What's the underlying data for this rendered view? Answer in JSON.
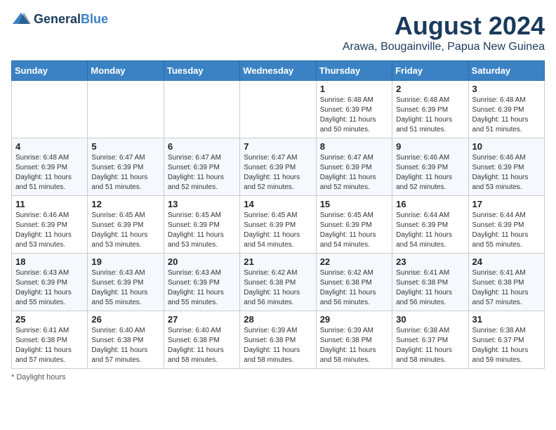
{
  "header": {
    "logo_general": "General",
    "logo_blue": "Blue",
    "month_year": "August 2024",
    "location": "Arawa, Bougainville, Papua New Guinea"
  },
  "weekdays": [
    "Sunday",
    "Monday",
    "Tuesday",
    "Wednesday",
    "Thursday",
    "Friday",
    "Saturday"
  ],
  "footer": {
    "note": "Daylight hours"
  },
  "weeks": [
    [
      {
        "day": "",
        "info": ""
      },
      {
        "day": "",
        "info": ""
      },
      {
        "day": "",
        "info": ""
      },
      {
        "day": "",
        "info": ""
      },
      {
        "day": "1",
        "info": "Sunrise: 6:48 AM\nSunset: 6:39 PM\nDaylight: 11 hours\nand 50 minutes."
      },
      {
        "day": "2",
        "info": "Sunrise: 6:48 AM\nSunset: 6:39 PM\nDaylight: 11 hours\nand 51 minutes."
      },
      {
        "day": "3",
        "info": "Sunrise: 6:48 AM\nSunset: 6:39 PM\nDaylight: 11 hours\nand 51 minutes."
      }
    ],
    [
      {
        "day": "4",
        "info": "Sunrise: 6:48 AM\nSunset: 6:39 PM\nDaylight: 11 hours\nand 51 minutes."
      },
      {
        "day": "5",
        "info": "Sunrise: 6:47 AM\nSunset: 6:39 PM\nDaylight: 11 hours\nand 51 minutes."
      },
      {
        "day": "6",
        "info": "Sunrise: 6:47 AM\nSunset: 6:39 PM\nDaylight: 11 hours\nand 52 minutes."
      },
      {
        "day": "7",
        "info": "Sunrise: 6:47 AM\nSunset: 6:39 PM\nDaylight: 11 hours\nand 52 minutes."
      },
      {
        "day": "8",
        "info": "Sunrise: 6:47 AM\nSunset: 6:39 PM\nDaylight: 11 hours\nand 52 minutes."
      },
      {
        "day": "9",
        "info": "Sunrise: 6:46 AM\nSunset: 6:39 PM\nDaylight: 11 hours\nand 52 minutes."
      },
      {
        "day": "10",
        "info": "Sunrise: 6:46 AM\nSunset: 6:39 PM\nDaylight: 11 hours\nand 53 minutes."
      }
    ],
    [
      {
        "day": "11",
        "info": "Sunrise: 6:46 AM\nSunset: 6:39 PM\nDaylight: 11 hours\nand 53 minutes."
      },
      {
        "day": "12",
        "info": "Sunrise: 6:45 AM\nSunset: 6:39 PM\nDaylight: 11 hours\nand 53 minutes."
      },
      {
        "day": "13",
        "info": "Sunrise: 6:45 AM\nSunset: 6:39 PM\nDaylight: 11 hours\nand 53 minutes."
      },
      {
        "day": "14",
        "info": "Sunrise: 6:45 AM\nSunset: 6:39 PM\nDaylight: 11 hours\nand 54 minutes."
      },
      {
        "day": "15",
        "info": "Sunrise: 6:45 AM\nSunset: 6:39 PM\nDaylight: 11 hours\nand 54 minutes."
      },
      {
        "day": "16",
        "info": "Sunrise: 6:44 AM\nSunset: 6:39 PM\nDaylight: 11 hours\nand 54 minutes."
      },
      {
        "day": "17",
        "info": "Sunrise: 6:44 AM\nSunset: 6:39 PM\nDaylight: 11 hours\nand 55 minutes."
      }
    ],
    [
      {
        "day": "18",
        "info": "Sunrise: 6:43 AM\nSunset: 6:39 PM\nDaylight: 11 hours\nand 55 minutes."
      },
      {
        "day": "19",
        "info": "Sunrise: 6:43 AM\nSunset: 6:39 PM\nDaylight: 11 hours\nand 55 minutes."
      },
      {
        "day": "20",
        "info": "Sunrise: 6:43 AM\nSunset: 6:39 PM\nDaylight: 11 hours\nand 55 minutes."
      },
      {
        "day": "21",
        "info": "Sunrise: 6:42 AM\nSunset: 6:38 PM\nDaylight: 11 hours\nand 56 minutes."
      },
      {
        "day": "22",
        "info": "Sunrise: 6:42 AM\nSunset: 6:38 PM\nDaylight: 11 hours\nand 56 minutes."
      },
      {
        "day": "23",
        "info": "Sunrise: 6:41 AM\nSunset: 6:38 PM\nDaylight: 11 hours\nand 56 minutes."
      },
      {
        "day": "24",
        "info": "Sunrise: 6:41 AM\nSunset: 6:38 PM\nDaylight: 11 hours\nand 57 minutes."
      }
    ],
    [
      {
        "day": "25",
        "info": "Sunrise: 6:41 AM\nSunset: 6:38 PM\nDaylight: 11 hours\nand 57 minutes."
      },
      {
        "day": "26",
        "info": "Sunrise: 6:40 AM\nSunset: 6:38 PM\nDaylight: 11 hours\nand 57 minutes."
      },
      {
        "day": "27",
        "info": "Sunrise: 6:40 AM\nSunset: 6:38 PM\nDaylight: 11 hours\nand 58 minutes."
      },
      {
        "day": "28",
        "info": "Sunrise: 6:39 AM\nSunset: 6:38 PM\nDaylight: 11 hours\nand 58 minutes."
      },
      {
        "day": "29",
        "info": "Sunrise: 6:39 AM\nSunset: 6:38 PM\nDaylight: 11 hours\nand 58 minutes."
      },
      {
        "day": "30",
        "info": "Sunrise: 6:38 AM\nSunset: 6:37 PM\nDaylight: 11 hours\nand 58 minutes."
      },
      {
        "day": "31",
        "info": "Sunrise: 6:38 AM\nSunset: 6:37 PM\nDaylight: 11 hours\nand 59 minutes."
      }
    ]
  ]
}
